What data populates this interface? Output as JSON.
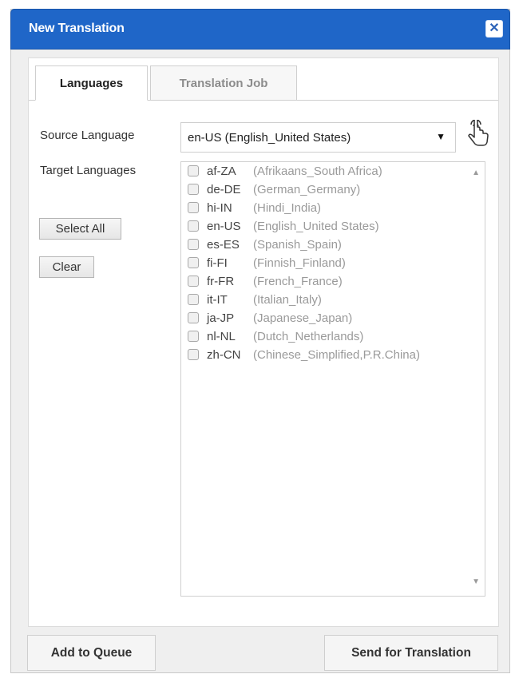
{
  "dialog": {
    "title": "New Translation",
    "close_icon": "close-icon"
  },
  "tabs": [
    {
      "label": "Languages",
      "active": true
    },
    {
      "label": "Translation Job",
      "active": false
    }
  ],
  "form": {
    "source_label": "Source Language",
    "source_value": "en-US  (English_United States)",
    "target_label": "Target Languages",
    "select_all_label": "Select All",
    "clear_label": "Clear",
    "pointer_icon": "hand-pointer-icon"
  },
  "languages": [
    {
      "code": "af-ZA",
      "name": "(Afrikaans_South Africa)"
    },
    {
      "code": "de-DE",
      "name": "(German_Germany)"
    },
    {
      "code": "hi-IN",
      "name": "(Hindi_India)"
    },
    {
      "code": "en-US",
      "name": "(English_United States)"
    },
    {
      "code": "es-ES",
      "name": "(Spanish_Spain)"
    },
    {
      "code": "fi-FI",
      "name": "(Finnish_Finland)"
    },
    {
      "code": "fr-FR",
      "name": "(French_France)"
    },
    {
      "code": "it-IT",
      "name": "(Italian_Italy)"
    },
    {
      "code": "ja-JP",
      "name": "(Japanese_Japan)"
    },
    {
      "code": "nl-NL",
      "name": "(Dutch_Netherlands)"
    },
    {
      "code": "zh-CN",
      "name": "(Chinese_Simplified,P.R.China)"
    }
  ],
  "footer": {
    "add_to_queue_label": "Add to Queue",
    "send_label": "Send for Translation"
  },
  "colors": {
    "titlebar": "#1f66c8",
    "background": "#efefef"
  }
}
